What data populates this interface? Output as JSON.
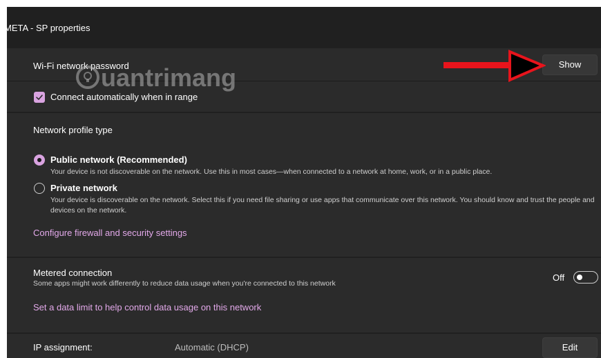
{
  "window": {
    "title": "META - SP properties"
  },
  "wifi": {
    "password_label": "Wi-Fi network password",
    "show_button": "Show",
    "auto_connect_label": "Connect automatically when in range",
    "auto_connect_checked": true
  },
  "watermark": {
    "text": "uantrimang"
  },
  "profile": {
    "heading": "Network profile type",
    "options": [
      {
        "label": "Public network (Recommended)",
        "description": "Your device is not discoverable on the network. Use this in most cases—when connected to a network at home, work, or in a public place.",
        "selected": true
      },
      {
        "label": "Private network",
        "description": "Your device is discoverable on the network. Select this if you need file sharing or use apps that communicate over this network. You should know and trust the people and devices on the network.",
        "selected": false
      }
    ],
    "firewall_link": "Configure firewall and security settings"
  },
  "metered": {
    "title": "Metered connection",
    "description": "Some apps might work differently to reduce data usage when you're connected to this network",
    "toggle_label": "Off",
    "data_limit_link": "Set a data limit to help control data usage on this network"
  },
  "ip": {
    "label": "IP assignment:",
    "value": "Automatic (DHCP)",
    "edit_button": "Edit"
  },
  "colors": {
    "accent": "#d9a3e0",
    "link": "#e3a9ea",
    "arrow": "#e8141c",
    "background": "#202020",
    "card": "#2b2b2b"
  }
}
